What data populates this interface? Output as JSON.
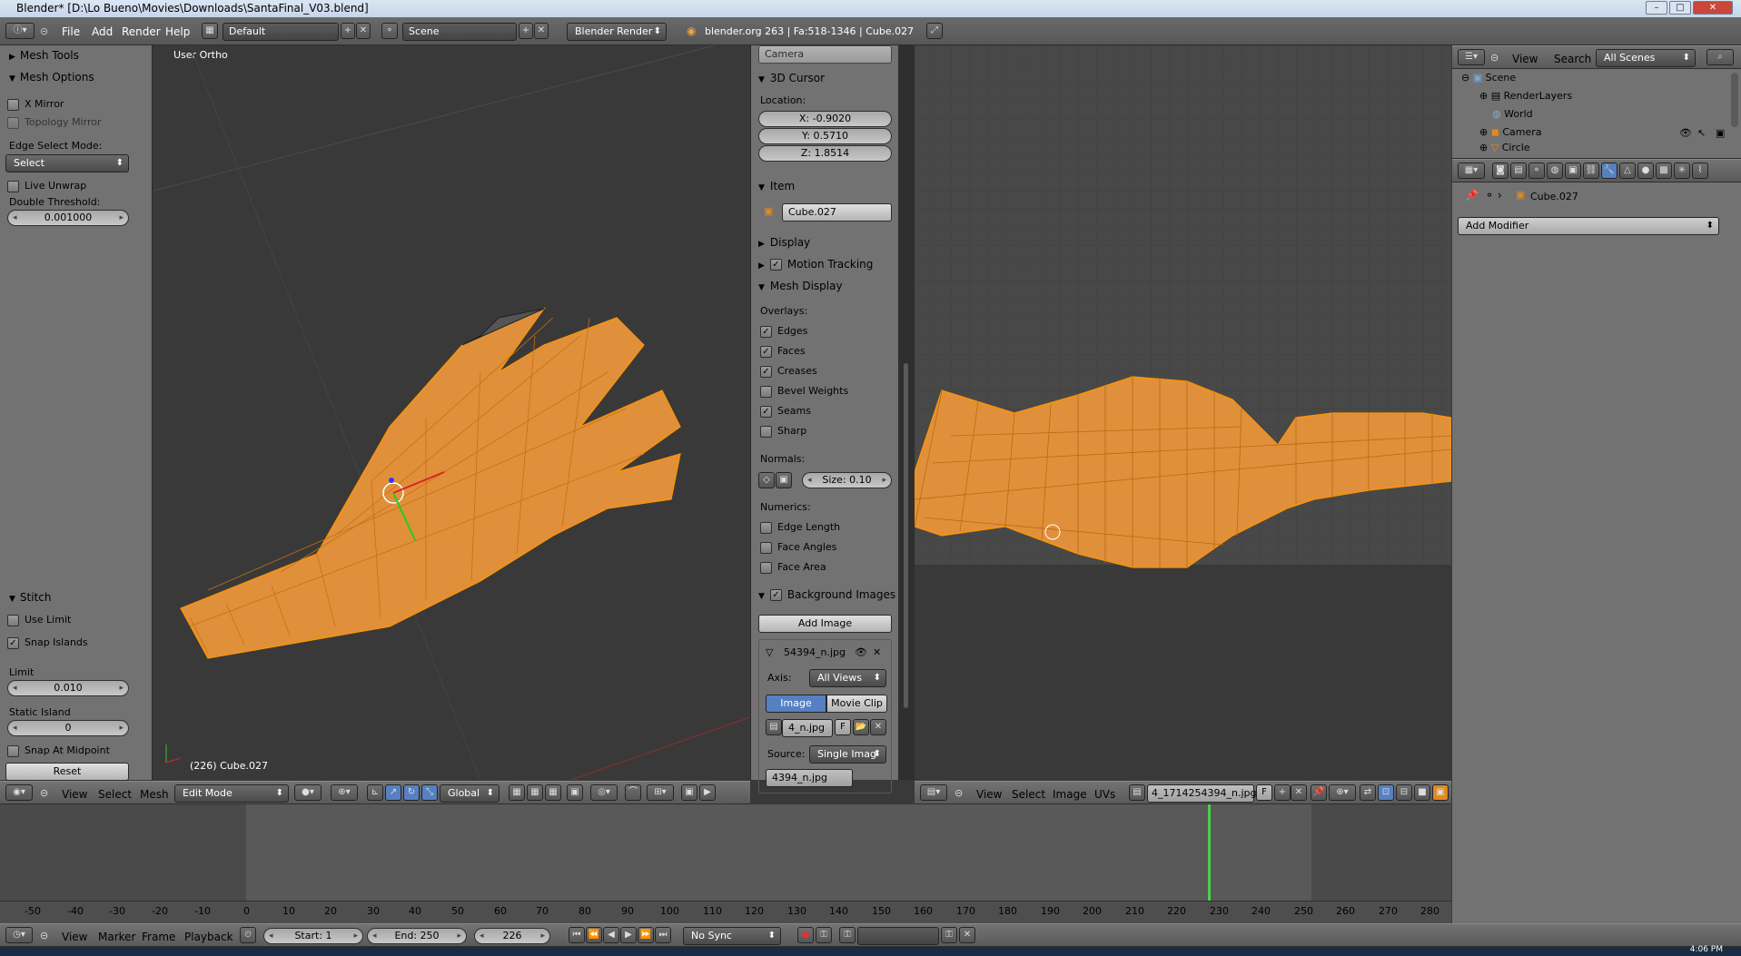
{
  "titlebar": {
    "title": "Blender* [D:\\Lo Bueno\\Movies\\Downloads\\SantaFinal_V03.blend]",
    "min": "–",
    "max": "□",
    "close": "✕"
  },
  "info": {
    "menus": [
      "File",
      "Add",
      "Render",
      "Help"
    ],
    "layout": "Default",
    "scene": "Scene",
    "engine": "Blender Render",
    "stats": "blender.org 263 | Fa:518-1346 | Cube.027"
  },
  "toolshelf": {
    "mesh_tools": "Mesh Tools",
    "mesh_options": "Mesh Options",
    "x_mirror": "X Mirror",
    "topology_mirror": "Topology Mirror",
    "edge_select_label": "Edge Select Mode:",
    "edge_select_value": "Select",
    "live_unwrap": "Live Unwrap",
    "double_threshold_label": "Double Threshold:",
    "double_threshold": "0.001000",
    "stitch": "Stitch",
    "use_limit": "Use Limit",
    "snap_islands": "Snap Islands",
    "limit_label": "Limit",
    "limit": "0.010",
    "static_island_label": "Static Island",
    "static_island": "0",
    "snap_midpoint": "Snap At Midpoint",
    "reset": "Reset"
  },
  "viewport": {
    "view_label": "User Ortho",
    "object_label": "(226) Cube.027",
    "menus": [
      "View",
      "Select",
      "Mesh"
    ],
    "mode": "Edit Mode",
    "orientation": "Global"
  },
  "npanel": {
    "camera": "Camera",
    "cursor": "3D Cursor",
    "location": "Location:",
    "x": "X: -0.9020",
    "y": "Y: 0.5710",
    "z": "Z: 1.8514",
    "item": "Item",
    "item_name": "Cube.027",
    "display": "Display",
    "motion_tracking": "Motion Tracking",
    "mesh_display": "Mesh Display",
    "overlays": "Overlays:",
    "edges": "Edges",
    "faces": "Faces",
    "creases": "Creases",
    "bevel_weights": "Bevel Weights",
    "seams": "Seams",
    "sharp": "Sharp",
    "normals": "Normals:",
    "size": "Size: 0.10",
    "numerics": "Numerics:",
    "edge_length": "Edge Length",
    "face_angles": "Face Angles",
    "face_area": "Face Area",
    "bg_images": "Background Images",
    "add_image": "Add Image",
    "img_name": "54394_n.jpg",
    "axis_label": "Axis:",
    "axis": "All Views",
    "image_tab": "Image",
    "movieclip_tab": "Movie Clip",
    "img_field": "4_n.jpg",
    "f": "F",
    "source_label": "Source:",
    "source": "Single Imag",
    "img_field2": "4394_n.jpg"
  },
  "uv": {
    "menus": [
      "View",
      "Select",
      "Image",
      "UVs"
    ],
    "image": "4_1714254394_n.jpg",
    "f": "F"
  },
  "outliner": {
    "menus": [
      "View",
      "Search"
    ],
    "filter": "All Scenes",
    "items": [
      "Scene",
      "RenderLayers",
      "World",
      "Camera",
      "Circle"
    ]
  },
  "props": {
    "object": "Cube.027",
    "add_modifier": "Add Modifier"
  },
  "timeline": {
    "ticks": [
      "-50",
      "-40",
      "-30",
      "-20",
      "-10",
      "0",
      "10",
      "20",
      "30",
      "40",
      "50",
      "60",
      "70",
      "80",
      "90",
      "100",
      "110",
      "120",
      "130",
      "140",
      "150",
      "160",
      "170",
      "180",
      "190",
      "200",
      "210",
      "220",
      "230",
      "240",
      "250",
      "260",
      "270",
      "280"
    ],
    "menus": [
      "View",
      "Marker",
      "Frame",
      "Playback"
    ],
    "start": "Start: 1",
    "end": "End: 250",
    "current": "226",
    "sync": "No Sync"
  },
  "clock": "4:06 PM",
  "colors": {
    "mesh": "#e8922a",
    "wire": "#ff9400",
    "bg": "#393939",
    "accent": "#5680c2"
  }
}
